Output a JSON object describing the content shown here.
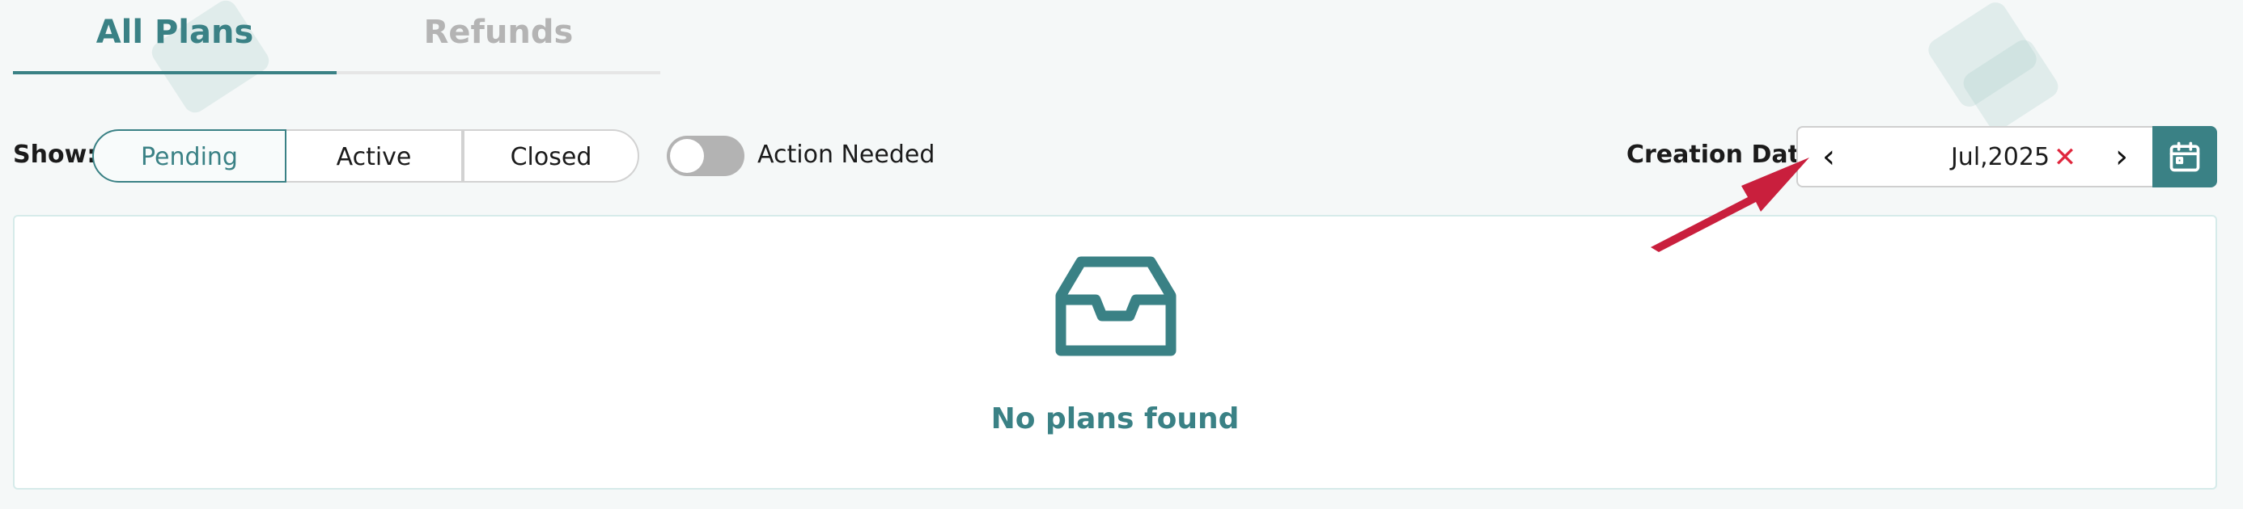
{
  "tabs": {
    "all_plans": "All Plans",
    "refunds": "Refunds"
  },
  "filters": {
    "show_label": "Show:",
    "options": [
      "Pending",
      "Active",
      "Closed"
    ],
    "selected": "Pending",
    "toggle_label": "Action Needed",
    "toggle_on": false
  },
  "date_filter": {
    "label": "Creation Date:",
    "value": "Jul,2025",
    "clear_symbol": "✕",
    "prev_symbol": "‹",
    "next_symbol": "›"
  },
  "empty_state": {
    "icon": "inbox-icon",
    "message": "No plans found"
  },
  "colors": {
    "accent": "#3a8185",
    "clear": "#e0273d",
    "annotation_arrow": "#c91f3d"
  }
}
